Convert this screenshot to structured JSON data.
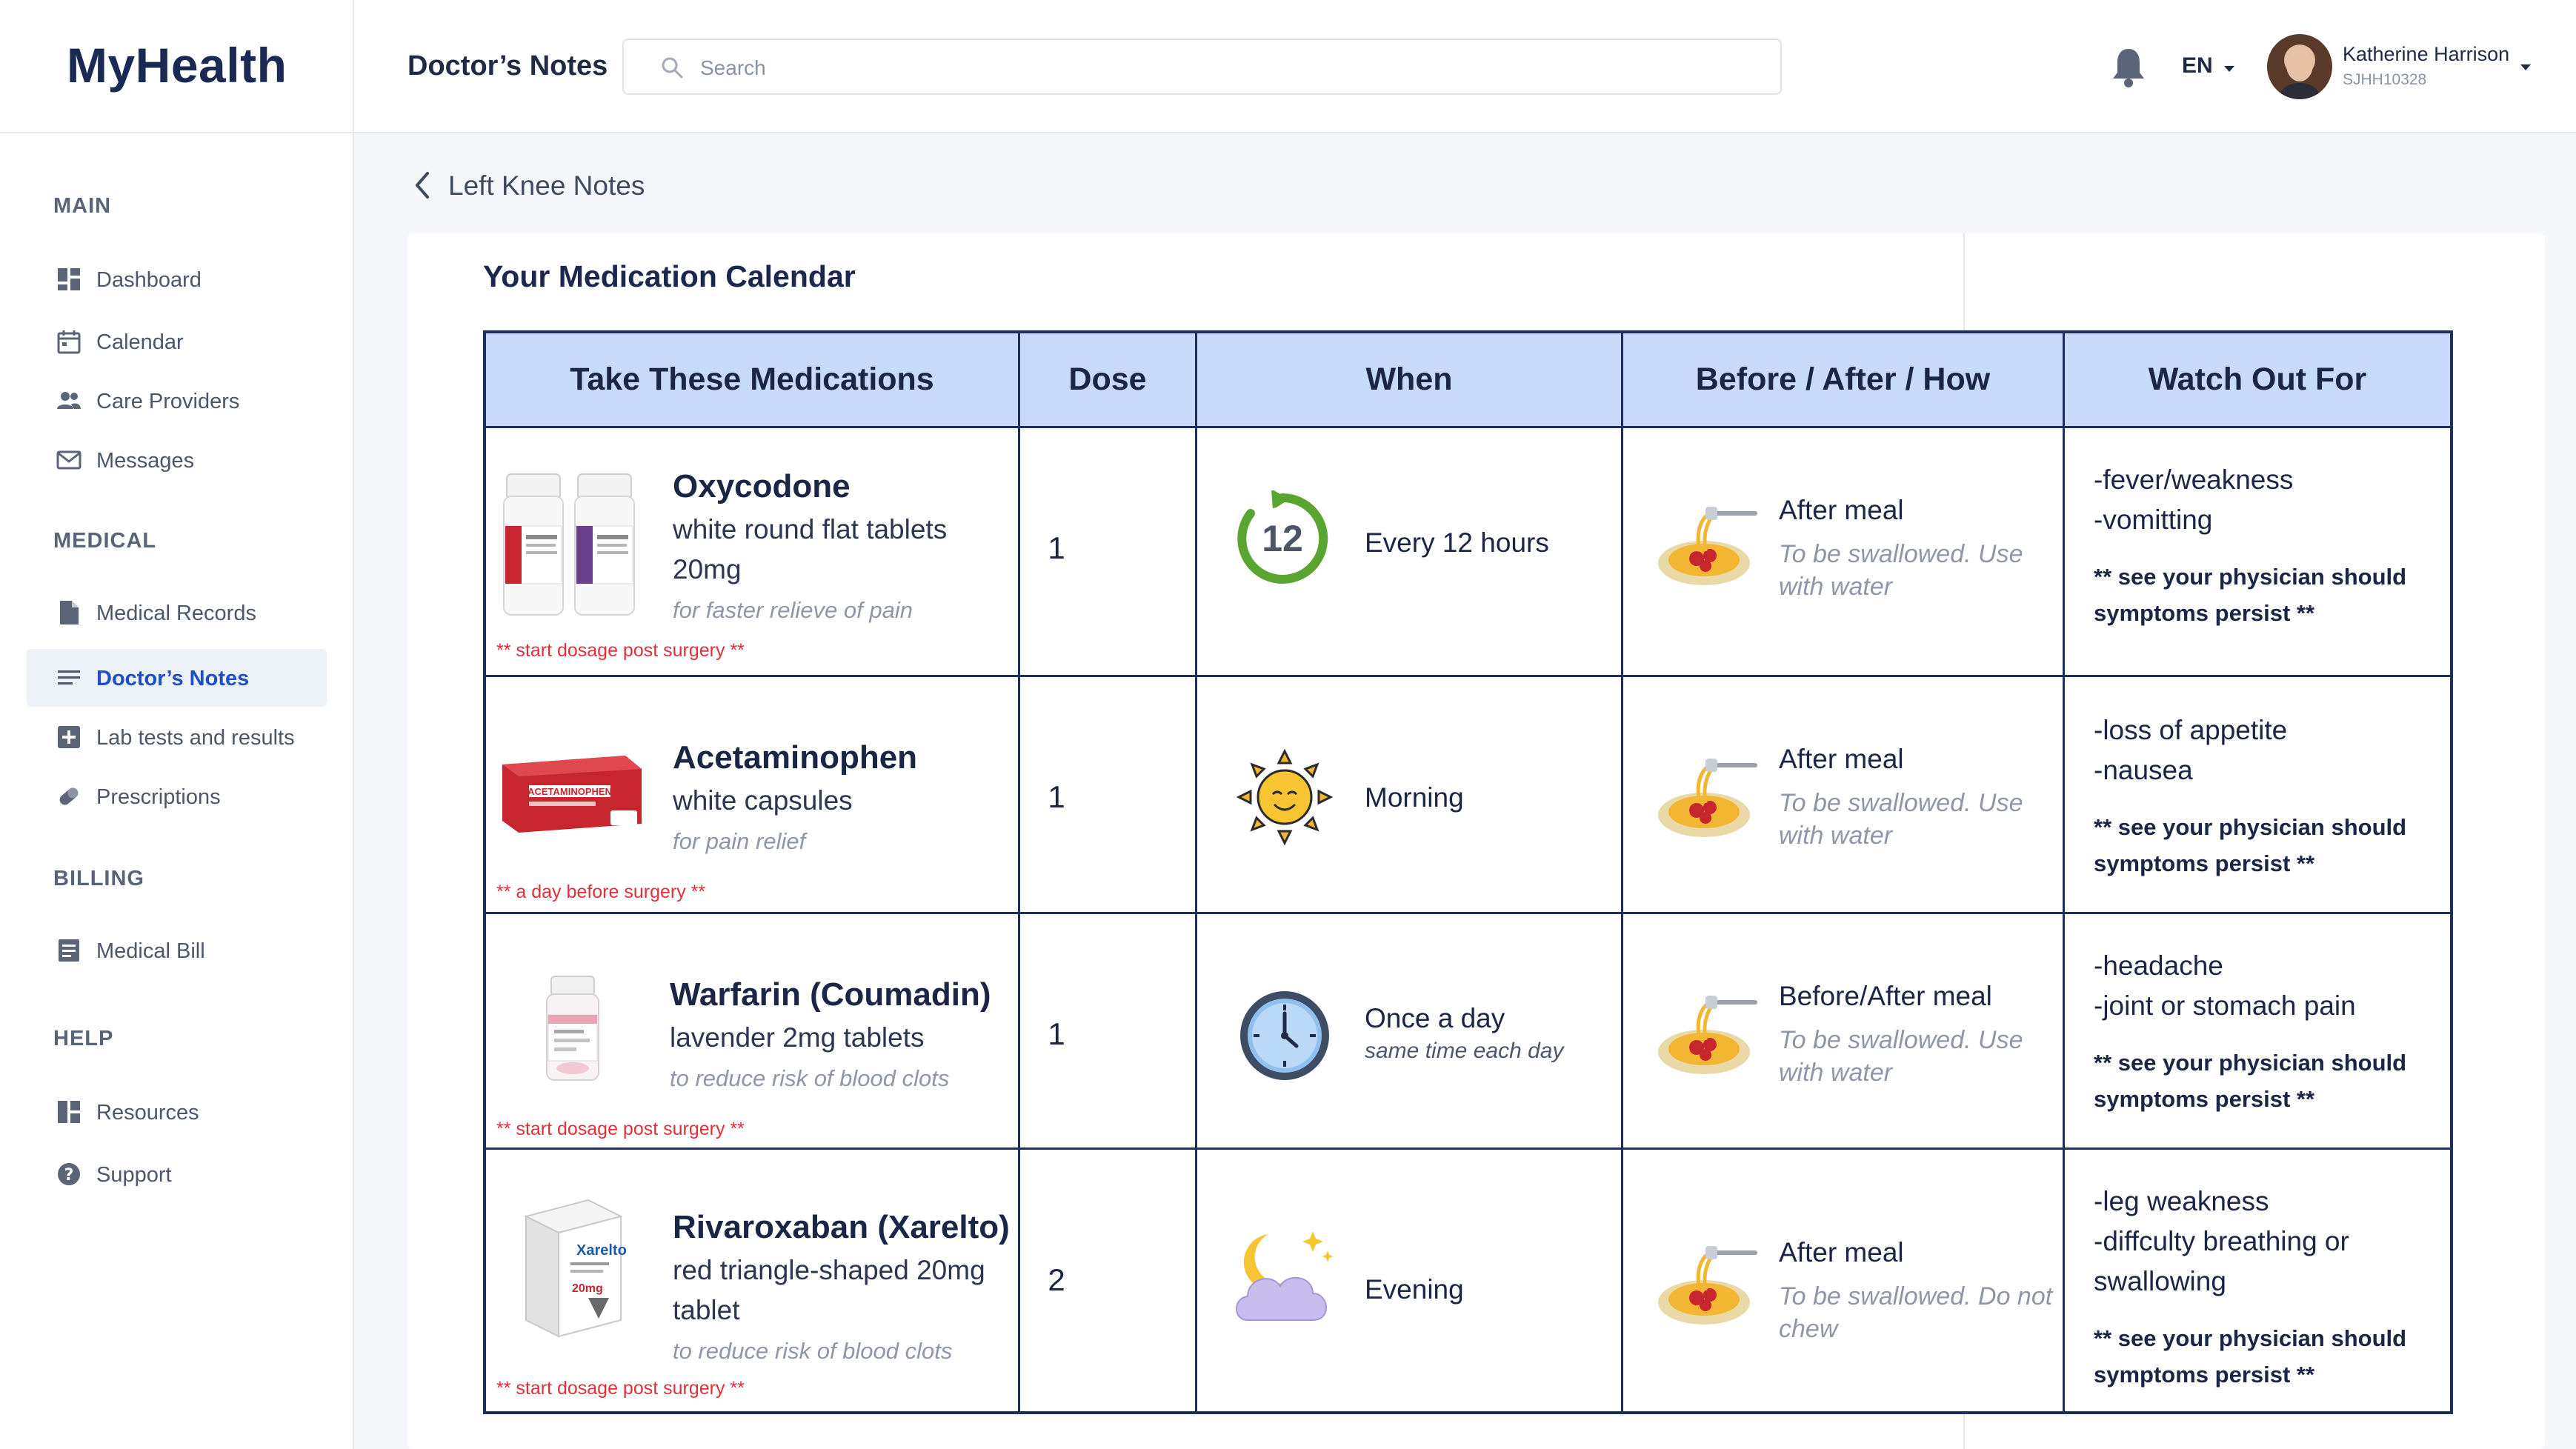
{
  "app": {
    "logo": "MyHealth",
    "section": "Doctor’s Notes"
  },
  "search": {
    "placeholder": "Search"
  },
  "header": {
    "language": "EN",
    "user_name": "Katherine Harrison",
    "user_id": "SJHH10328"
  },
  "sidebar": {
    "sections": [
      {
        "heading": "MAIN",
        "items": [
          {
            "label": "Dashboard",
            "icon": "dashboard-icon"
          },
          {
            "label": "Calendar",
            "icon": "calendar-icon"
          },
          {
            "label": "Care Providers",
            "icon": "people-icon"
          },
          {
            "label": "Messages",
            "icon": "envelope-icon"
          }
        ]
      },
      {
        "heading": "MEDICAL",
        "items": [
          {
            "label": "Medical Records",
            "icon": "document-icon"
          },
          {
            "label": "Doctor’s Notes",
            "icon": "notes-icon",
            "active": true
          },
          {
            "label": "Lab tests and results",
            "icon": "plus-box-icon"
          },
          {
            "label": "Prescriptions",
            "icon": "pill-icon"
          }
        ]
      },
      {
        "heading": "BILLING",
        "items": [
          {
            "label": "Medical Bill",
            "icon": "bill-icon"
          }
        ]
      },
      {
        "heading": "HELP",
        "items": [
          {
            "label": "Resources",
            "icon": "resources-icon"
          },
          {
            "label": "Support",
            "icon": "help-icon"
          }
        ]
      }
    ]
  },
  "page": {
    "back_label": "Left Knee Notes",
    "calendar_title": "Your Medication Calendar"
  },
  "table": {
    "headers": [
      "Take These Medications",
      "Dose",
      "When",
      "Before / After / How",
      "Watch Out For"
    ],
    "rows": [
      {
        "name": "Oxycodone",
        "desc": [
          "white round flat tablets",
          "20mg"
        ],
        "note": "for faster relieve of pain",
        "warning": "** start dosage post surgery **",
        "dose": "1",
        "when": "Every 12 hours",
        "when_sub": "",
        "when_icon": "clock-12-hours-icon",
        "how": "After meal",
        "how_sub": "To be swallowed. Use with water",
        "watch": [
          "-fever/weakness",
          "-vomitting"
        ],
        "watch_note": [
          "** see your physician should",
          "symptoms persist **"
        ]
      },
      {
        "name": "Acetaminophen",
        "desc": [
          "white capsules"
        ],
        "note": "for pain relief",
        "warning": "** a day before surgery **",
        "dose": "1",
        "when": "Morning",
        "when_sub": "",
        "when_icon": "sun-icon",
        "how": "After meal",
        "how_sub": "To be swallowed. Use with water",
        "watch": [
          "-loss of appetite",
          "-nausea"
        ],
        "watch_note": [
          "** see your physician should",
          "symptoms persist **"
        ]
      },
      {
        "name": "Warfarin (Coumadin)",
        "desc": [
          "lavender 2mg tablets"
        ],
        "note": "to reduce risk of blood clots",
        "warning": "** start dosage post surgery **",
        "dose": "1",
        "when": "Once a day",
        "when_sub": "same time each day",
        "when_icon": "clock-icon",
        "how": "Before/After meal",
        "how_sub": "To be swallowed. Use with water",
        "watch": [
          "-headache",
          "-joint or stomach pain"
        ],
        "watch_note": [
          "** see your physician should",
          "symptoms persist **"
        ]
      },
      {
        "name": "Rivaroxaban (Xarelto)",
        "desc": [
          "red triangle-shaped 20mg",
          "tablet"
        ],
        "note": "to reduce risk of blood clots",
        "warning": "** start dosage post surgery **",
        "dose": "2",
        "when": "Evening",
        "when_sub": "",
        "when_icon": "moon-cloud-icon",
        "how": "After meal",
        "how_sub": "To be swallowed. Do not chew",
        "watch": [
          "-leg weakness",
          "-diffculty breathing or",
          "swallowing"
        ],
        "watch_note": [
          "** see your physician should",
          "symptoms persist **"
        ]
      }
    ]
  },
  "colors": {
    "header_fill": "#c8daf9",
    "table_border": "#1f2f5c",
    "active_nav": "#1e4fc4",
    "warning": "#e0313a"
  }
}
